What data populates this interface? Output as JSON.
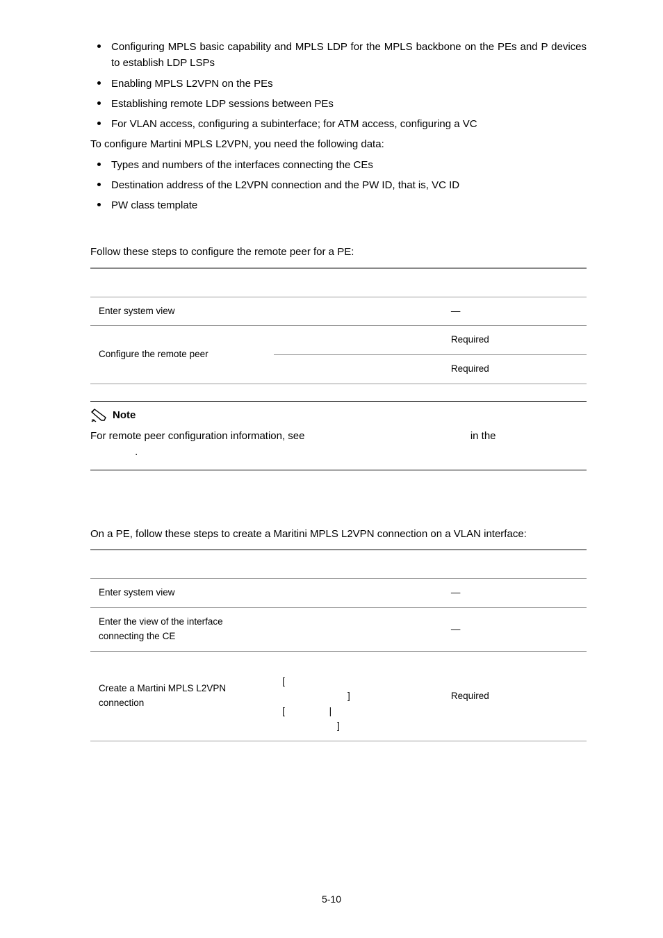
{
  "bullets1": [
    "Configuring MPLS basic capability and MPLS LDP for the MPLS backbone on the PEs and P devices to establish LDP LSPs",
    "Enabling MPLS L2VPN on the PEs",
    "Establishing remote LDP sessions between PEs",
    "For VLAN access, configuring a subinterface; for ATM access, configuring a VC"
  ],
  "line_after_bullets1": "To configure Martini MPLS L2VPN, you need the following data:",
  "bullets2": [
    "Types and numbers of the interfaces connecting the CEs",
    "Destination address of the L2VPN connection and the PW ID, that is, VC ID",
    "PW class template"
  ],
  "table1_intro": "Follow these steps to configure the remote peer for a PE:",
  "table1": {
    "rows": [
      {
        "todo": "Enter system view",
        "cmd": "",
        "remarks": "—"
      },
      {
        "todo_rowspan": "Configure the remote peer",
        "cmd": "",
        "remarks": "Required"
      },
      {
        "cmd": "",
        "remarks": "Required"
      }
    ]
  },
  "note": {
    "title": "Note",
    "line1_a": "For remote peer configuration information, see ",
    "line1_b": " in the ",
    "line2": "."
  },
  "table2_intro": "On a PE, follow these steps to create a Maritini MPLS L2VPN connection on a VLAN interface:",
  "table2": {
    "rows": [
      {
        "todo": "Enter system view",
        "cmd": "",
        "remarks": "—"
      },
      {
        "todo": "Enter the view of the interface connecting the CE",
        "cmd": "",
        "remarks": "—"
      },
      {
        "todo": "Create a Martini MPLS L2VPN connection",
        "cmd": "                                  \n[                                  \n                         ]\n[                 |\n                     ]",
        "remarks": "Required"
      }
    ]
  },
  "page_number": "5-10"
}
